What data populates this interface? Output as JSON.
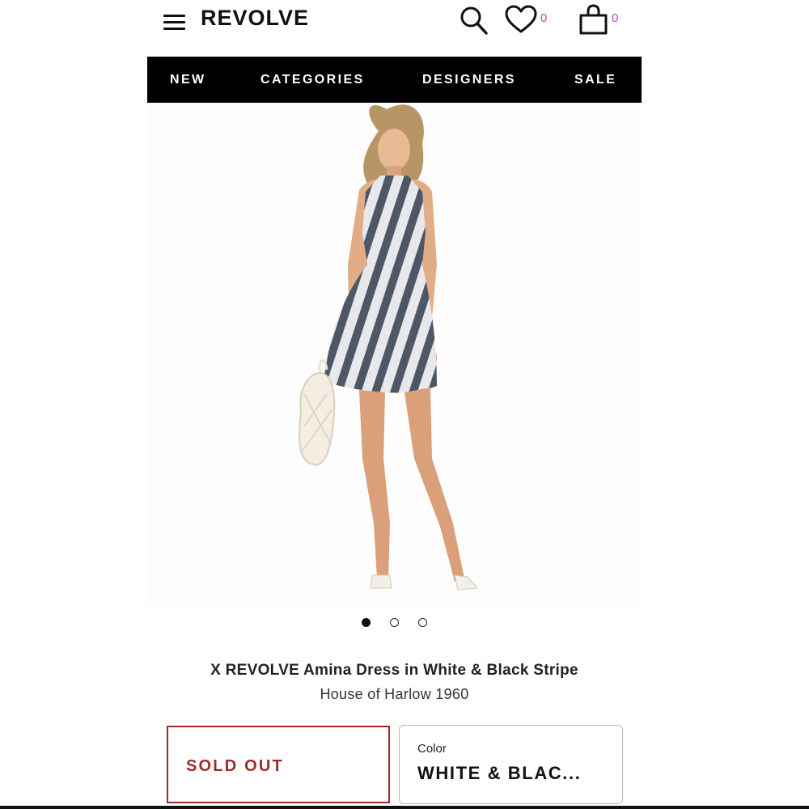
{
  "header": {
    "logo": "REVOLVE",
    "wishlist_count": "0",
    "bag_count": "0"
  },
  "nav": {
    "items": [
      "NEW",
      "CATEGORIES",
      "DESIGNERS",
      "SALE"
    ]
  },
  "gallery": {
    "image_count": 3,
    "active_index": 0
  },
  "product": {
    "title": "X REVOLVE Amina Dress in White & Black Stripe",
    "designer": "House of Harlow 1960"
  },
  "purchase": {
    "status_label": "SOLD OUT",
    "color_label": "Color",
    "color_value": "WHITE & BLAC..."
  },
  "colors": {
    "nav_bg": "#000000",
    "count_badge": "#d43fa8",
    "sold_out": "#9a2b2b",
    "stripe_dark": "#4e5766",
    "stripe_light": "#e6e8ec"
  },
  "icons": {
    "menu": "hamburger-icon",
    "search": "search-icon",
    "wishlist": "heart-icon",
    "bag": "shopping-bag-icon"
  }
}
